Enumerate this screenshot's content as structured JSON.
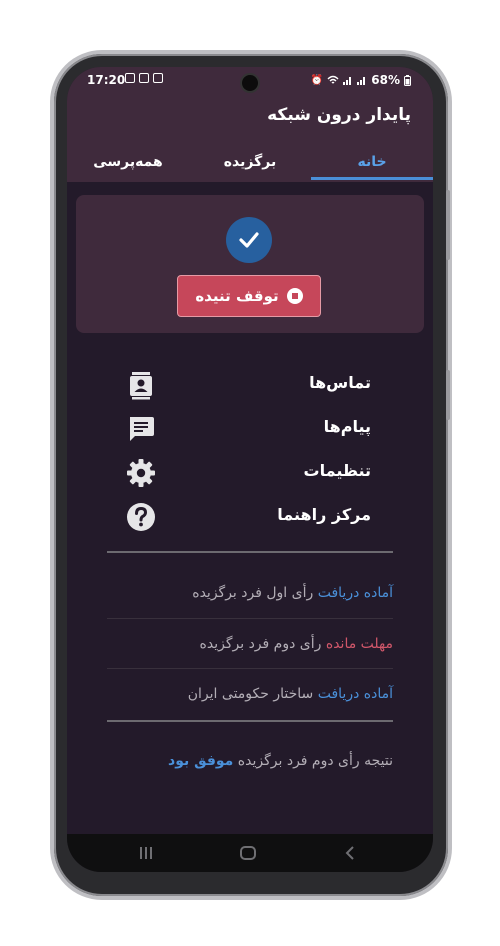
{
  "status_bar": {
    "time": "17:20",
    "battery": "68%"
  },
  "app": {
    "title": "پایدار درون شبکه"
  },
  "tabs": [
    {
      "label": "همه‌پرسی"
    },
    {
      "label": "برگزیده"
    },
    {
      "label": "خانه",
      "active": true
    }
  ],
  "status_card": {
    "stop_label": "توقف تنیده"
  },
  "menu": [
    {
      "label": "تماس‌ها",
      "icon": "contacts-icon"
    },
    {
      "label": "پیام‌ها",
      "icon": "message-icon"
    },
    {
      "label": "تنظیمات",
      "icon": "gear-icon"
    },
    {
      "label": "مرکز راهنما",
      "icon": "help-icon"
    }
  ],
  "polls": [
    {
      "status": "آماده دریافت",
      "status_color": "blue",
      "text": " رأی اول فرد برگزیده"
    },
    {
      "status": "مهلت مانده",
      "status_color": "red",
      "text": " رأی دوم فرد برگزیده"
    },
    {
      "status": "آماده دریافت",
      "status_color": "blue",
      "text": " ساختار حکومتی ایران"
    }
  ],
  "result": {
    "text": "نتیجه رأی دوم فرد برگزیده ",
    "highlight": "موفق بود"
  },
  "colors": {
    "app_bar": "#3f2a3c",
    "background": "#231a2a",
    "accent_blue": "#4a90d9",
    "danger": "#c6475a"
  }
}
